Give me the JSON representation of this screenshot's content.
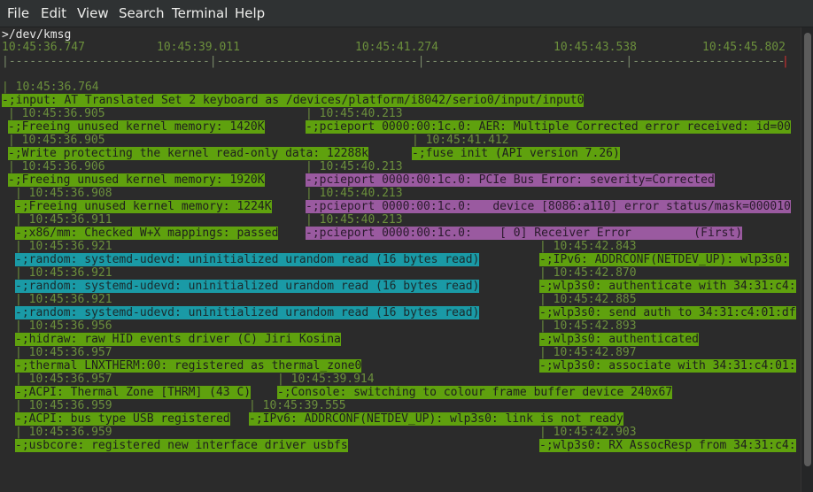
{
  "menu": [
    "File",
    "Edit",
    "View",
    "Search",
    "Terminal",
    "Help"
  ],
  "path": ">/dev/kmsg",
  "axis": {
    "times": [
      "10:45:36.747",
      "10:45:39.011",
      "10:45:41.274",
      "10:45:43.538",
      "10:45:45.802"
    ],
    "ruler": "|-----------------------------|-----------------------------|-----------------------------|-----------------------------|"
  },
  "lines": [
    {
      "ts": "| 10:45:36.764",
      "msg": "-;input: AT Translated Set 2 keyboard as /devices/platform/i8042/serio0/input/input0",
      "color": "green"
    },
    {
      "ts": "| 10:45:36.905",
      "msg": "-;Freeing unused kernel memory: 1420K",
      "color": "green"
    },
    {
      "ts": "| 10:45:40.213",
      "msg": "-;pcieport 0000:00:1c.0: AER: Multiple Corrected error received: id=00",
      "color": "green"
    },
    {
      "ts": "| 10:45:36.905",
      "msg": "-;Write protecting the kernel read-only data: 12288k",
      "color": "green"
    },
    {
      "ts": "| 10:45:41.412",
      "msg": "-;fuse init (API version 7.26)",
      "color": "green"
    },
    {
      "ts": "| 10:45:36.906",
      "msg": "-;Freeing unused kernel memory: 1920K",
      "color": "green"
    },
    {
      "ts": "| 10:45:40.213",
      "msg": "-;pcieport 0000:00:1c.0: PCIe Bus Error: severity=Corrected",
      "color": "purple"
    },
    {
      "ts": "| 10:45:36.908",
      "msg": "-;Freeing unused kernel memory: 1224K",
      "color": "green"
    },
    {
      "ts": "| 10:45:40.213",
      "msg": "-;pcieport 0000:00:1c.0:   device [8086:a110] error status/mask=000010",
      "color": "purple"
    },
    {
      "ts": "| 10:45:36.911",
      "msg": "-;x86/mm: Checked W+X mappings: passed",
      "color": "green"
    },
    {
      "ts": "| 10:45:40.213",
      "msg": "-;pcieport 0000:00:1c.0:    [ 0] Receiver Error         (First)",
      "color": "purple"
    },
    {
      "ts": "| 10:45:36.921",
      "msg": "-;random: systemd-udevd: uninitialized urandom read (16 bytes read)",
      "color": "cyan"
    },
    {
      "ts": "| 10:45:42.843",
      "msg": "-;IPv6: ADDRCONF(NETDEV_UP): wlp3s0:",
      "color": "green"
    },
    {
      "ts": "| 10:45:36.921",
      "msg": "-;random: systemd-udevd: uninitialized urandom read (16 bytes read)",
      "color": "cyan"
    },
    {
      "ts": "| 10:45:42.870",
      "msg": "-;wlp3s0: authenticate with 34:31:c4:",
      "color": "green"
    },
    {
      "ts": "| 10:45:36.921",
      "msg": "-;random: systemd-udevd: uninitialized urandom read (16 bytes read)",
      "color": "cyan"
    },
    {
      "ts": "| 10:45:42.885",
      "msg": "-;wlp3s0: send auth to 34:31:c4:01:df",
      "color": "green"
    },
    {
      "ts": "| 10:45:36.956",
      "msg": "-;hidraw: raw HID events driver (C) Jiri Kosina",
      "color": "green"
    },
    {
      "ts": "| 10:45:42.893",
      "msg": "-;wlp3s0: authenticated",
      "color": "green"
    },
    {
      "ts": "| 10:45:36.957",
      "msg": "-;thermal LNXTHERM:00: registered as thermal_zone0",
      "color": "green"
    },
    {
      "ts": "| 10:45:42.897",
      "msg": "-;wlp3s0: associate with 34:31:c4:01:",
      "color": "green"
    },
    {
      "ts": "| 10:45:36.957",
      "msg": "-;ACPI: Thermal Zone [THRM] (43 C)",
      "color": "green"
    },
    {
      "ts": "| 10:45:39.914",
      "msg": "-;Console: switching to colour frame buffer device 240x67",
      "color": "green"
    },
    {
      "ts": "| 10:45:36.959",
      "msg": "-;ACPI: bus type USB registered",
      "color": "green"
    },
    {
      "ts": "| 10:45:39.555",
      "msg": "-;IPv6: ADDRCONF(NETDEV_UP): wlp3s0: link is not ready",
      "color": "green"
    },
    {
      "ts": "| 10:45:36.959",
      "msg": "-;usbcore: registered new interface driver usbfs",
      "color": "green"
    },
    {
      "ts": "| 10:45:42.903",
      "msg": "-;wlp3s0: RX AssocResp from 34:31:c4:",
      "color": "green"
    }
  ]
}
